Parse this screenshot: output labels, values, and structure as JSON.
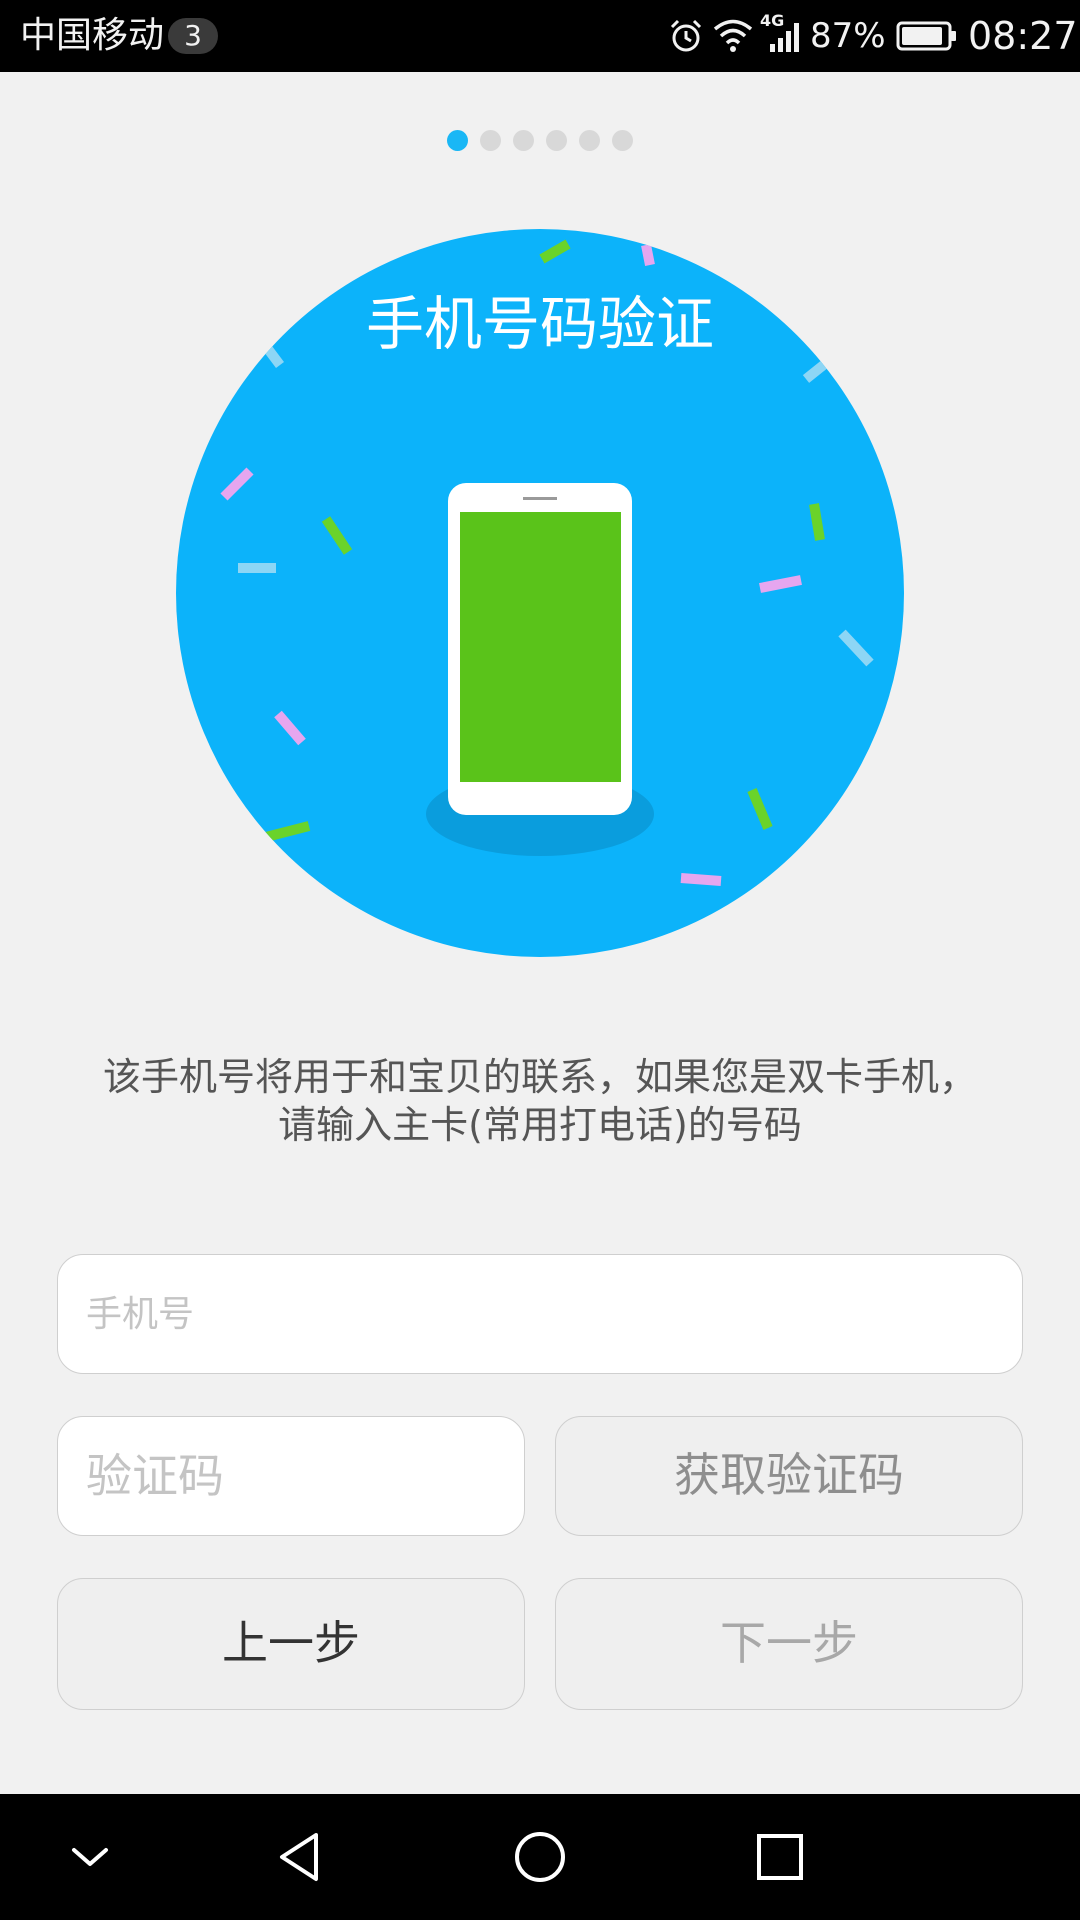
{
  "status_bar": {
    "carrier": "中国移动",
    "notification_count": "3",
    "network": "4G",
    "battery": "87%",
    "time": "08:27",
    "icons": [
      "alarm-icon",
      "wifi-icon",
      "signal-icon",
      "battery-icon"
    ]
  },
  "pager": {
    "total": 6,
    "current": 1
  },
  "hero": {
    "title": "手机号码验证",
    "colors": {
      "circle": "#0cb3fa",
      "screen": "#5ac31a"
    }
  },
  "description": {
    "line1": "该手机号将用于和宝贝的联系，如果您是双卡手机，",
    "line2": "请输入主卡(常用打电话)的号码"
  },
  "form": {
    "phone_placeholder": "手机号",
    "code_placeholder": "验证码",
    "get_code_label": "获取验证码"
  },
  "nav": {
    "prev_label": "上一步",
    "next_label": "下一步"
  },
  "system_nav": [
    "chevron-down-icon",
    "back-icon",
    "home-icon",
    "recents-icon"
  ]
}
